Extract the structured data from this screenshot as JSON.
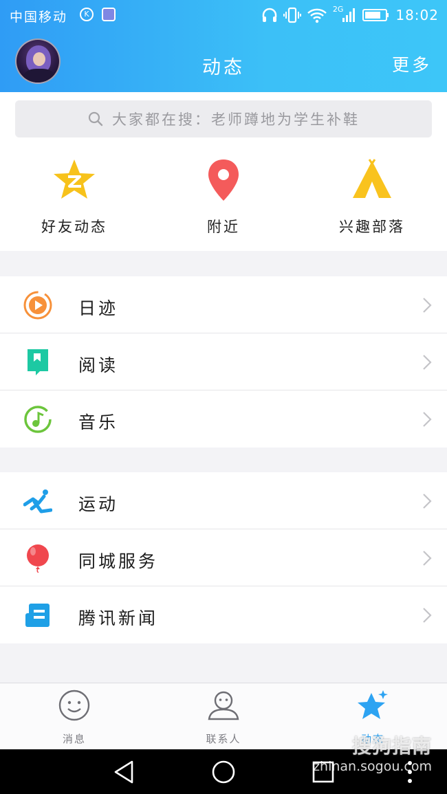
{
  "status_bar": {
    "carrier": "中国移动",
    "badge_letter": "K",
    "network": "2G",
    "time": "18:02"
  },
  "header": {
    "title": "动态",
    "more_label": "更多"
  },
  "search": {
    "placeholder": "大家都在搜：老师蹲地为学生补鞋"
  },
  "quick_actions": [
    {
      "label": "好友动态",
      "icon": "qzone-star-icon",
      "color": "#f7c21b"
    },
    {
      "label": "附近",
      "icon": "location-pin-icon",
      "color": "#f45b5b"
    },
    {
      "label": "兴趣部落",
      "icon": "tent-icon",
      "color": "#f9c31e"
    }
  ],
  "group1": [
    {
      "label": "日迹",
      "icon": "play-circle-icon",
      "color": "#f7913a"
    },
    {
      "label": "阅读",
      "icon": "book-icon",
      "color": "#1dc9a3"
    },
    {
      "label": "音乐",
      "icon": "music-note-icon",
      "color": "#6cc53c"
    }
  ],
  "group2": [
    {
      "label": "运动",
      "icon": "running-icon",
      "color": "#1f9ee8"
    },
    {
      "label": "同城服务",
      "icon": "balloon-icon",
      "color": "#f0474e"
    },
    {
      "label": "腾讯新闻",
      "icon": "news-icon",
      "color": "#1fa0e6"
    }
  ],
  "tabbar": {
    "tabs": [
      {
        "label": "消息",
        "icon": "smile-face-icon"
      },
      {
        "label": "联系人",
        "icon": "contact-person-icon"
      },
      {
        "label": "动态",
        "icon": "star-icon",
        "active": true
      }
    ]
  },
  "watermark": {
    "main": "搜狗指南",
    "sub": "zhinan.sogou.com"
  },
  "colors": {
    "header_start": "#2f9cf5",
    "header_end": "#3dc6f8",
    "active_tab": "#2da3f2"
  }
}
